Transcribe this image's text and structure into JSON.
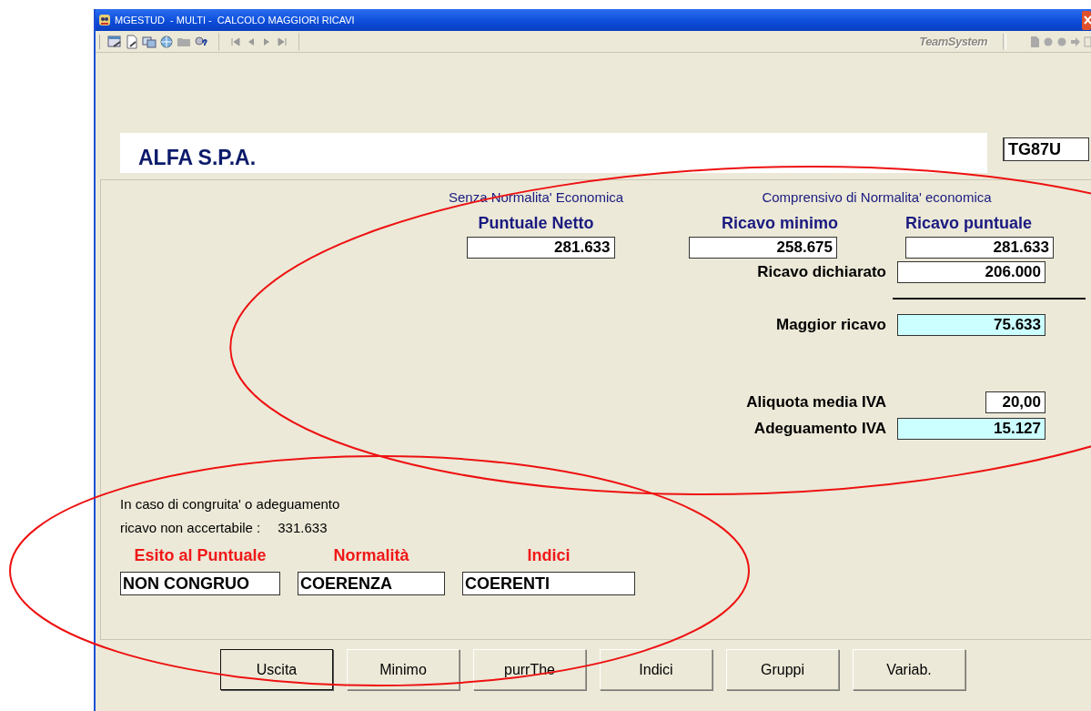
{
  "window": {
    "title": "MGESTUD  - MULTI -  CALCOLO MAGGIORI RICAVI",
    "logo": "TeamSystem"
  },
  "header": {
    "company": "ALFA S.P.A.",
    "code": "TG87U"
  },
  "results": {
    "group_left": "Senza Normalita' Economica",
    "group_right": "Comprensivo di Normalita' economica",
    "columns": [
      {
        "heading": "Puntuale Netto",
        "value": "281.633"
      },
      {
        "heading": "Ricavo minimo",
        "value": "258.675"
      },
      {
        "heading": "Ricavo puntuale",
        "value": "281.633"
      }
    ],
    "rows": [
      {
        "label": "Ricavo dichiarato",
        "value": "206.000",
        "highlighted": false,
        "kind": "wide"
      },
      {
        "label": "Maggior ricavo",
        "value": "75.633",
        "highlighted": true,
        "kind": "wide"
      },
      {
        "label": "Aliquota media IVA",
        "value": "20,00",
        "highlighted": false,
        "kind": "narrow"
      },
      {
        "label": "Adeguamento IVA",
        "value": "15.127",
        "highlighted": true,
        "kind": "wide"
      }
    ]
  },
  "note": {
    "line_1": "In caso di congruita' o adeguamento",
    "line_2": "ricavo non accertabile :",
    "value": "331.633"
  },
  "outcomes": [
    {
      "label": "Esito al Puntuale",
      "value": "NON CONGRUO"
    },
    {
      "label": "Normalità",
      "value": "COERENZA"
    },
    {
      "label": "Indici",
      "value": "COERENTI"
    }
  ],
  "buttons": [
    {
      "label": "Uscita",
      "default": true
    },
    {
      "label": "Minimo",
      "default": false
    },
    {
      "label": "purrThe",
      "default": false
    },
    {
      "label": "Indici",
      "default": false
    },
    {
      "label": "Gruppi",
      "default": false
    },
    {
      "label": "Variab.",
      "default": false
    }
  ]
}
